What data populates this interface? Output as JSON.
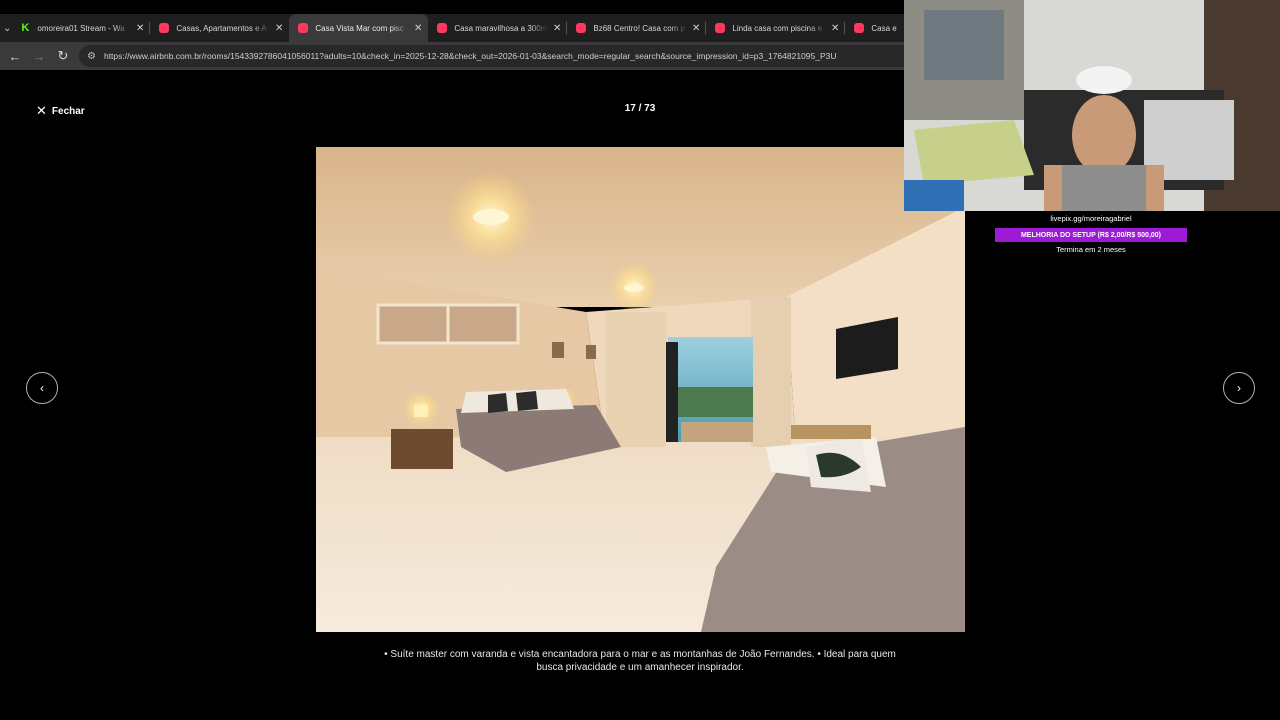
{
  "browser": {
    "tabs": [
      {
        "title": "omoreira01 Stream - Wa",
        "favicon": "kick-icon",
        "active": false
      },
      {
        "title": "Casas, Apartamentos e A",
        "favicon": "airbnb-icon",
        "active": false
      },
      {
        "title": "Casa Vista Mar com pisc",
        "favicon": "airbnb-icon",
        "active": true
      },
      {
        "title": "Casa maravilhosa a 300m",
        "favicon": "airbnb-icon",
        "active": false
      },
      {
        "title": "Bz68 Centro! Casa com p",
        "favicon": "airbnb-icon",
        "active": false
      },
      {
        "title": "Linda casa com piscina e",
        "favicon": "airbnb-icon",
        "active": false
      },
      {
        "title": "Casa e",
        "favicon": "airbnb-icon",
        "active": false
      }
    ],
    "url": "https://www.airbnb.com.br/rooms/1543392786041056011?adults=10&check_in=2025-12-28&check_out=2026-01-03&search_mode=regular_search&source_impression_id=p3_1764821095_P3U"
  },
  "gallery": {
    "close_label": "Fechar",
    "counter": "17 / 73",
    "caption_line1": "• Suíte master com varanda e vista encantadora para o mar e as montanhas de João Fernandes. • Ideal para quem",
    "caption_line2": "busca privacidade e um amanhecer inspirador."
  },
  "stream": {
    "donation_url": "livepix.gg/moreiragabriel",
    "goal_text": "MELHORIA DO SETUP (R$ 2,00/R$ 500,00)",
    "goal_progress": 0.004,
    "goal_ends": "Termina em 2 meses",
    "goal_color": "#9d1ad7"
  }
}
